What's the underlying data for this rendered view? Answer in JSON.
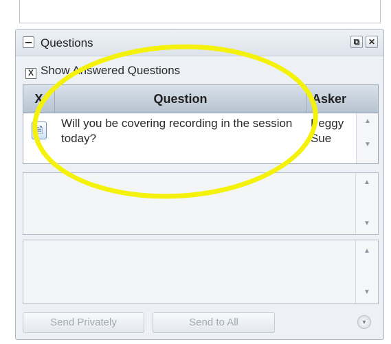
{
  "panel": {
    "title": "Questions",
    "icons": [
      "minus-icon",
      "restore-icon",
      "close-icon"
    ]
  },
  "show_answered": {
    "label": "Show Answered Questions",
    "checked": true,
    "check_glyph": "X"
  },
  "table": {
    "columns": [
      "X",
      "Question",
      "Asker"
    ],
    "rows": [
      {
        "question": "Will you be covering recording in the session today?",
        "asker": "Peggy Sue"
      }
    ]
  },
  "buttons": {
    "send_privately": "Send Privately",
    "send_to_all": "Send to All"
  },
  "colors": {
    "highlight": "#f4f20a",
    "panel_bg": "#edf1f5",
    "header_grad_top": "#d9e1ea"
  }
}
